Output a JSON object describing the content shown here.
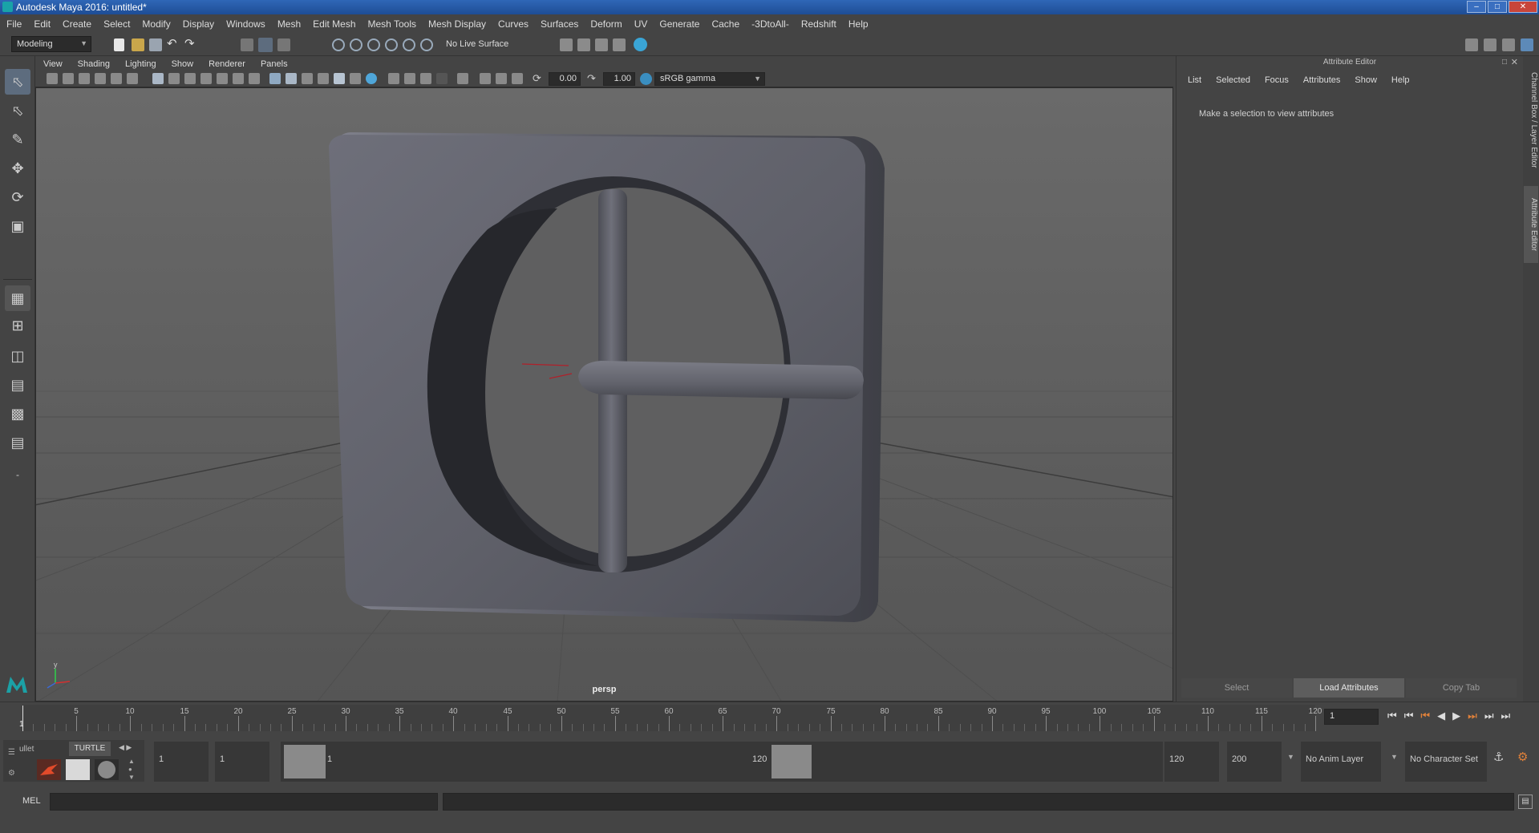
{
  "window": {
    "title": "Autodesk Maya 2016: untitled*"
  },
  "menubar": [
    "File",
    "Edit",
    "Create",
    "Select",
    "Modify",
    "Display",
    "Windows",
    "Mesh",
    "Edit Mesh",
    "Mesh Tools",
    "Mesh Display",
    "Curves",
    "Surfaces",
    "Deform",
    "UV",
    "Generate",
    "Cache",
    "-3DtoAll-",
    "Redshift",
    "Help"
  ],
  "toolbar": {
    "mode": "Modeling",
    "live_surface": "No Live Surface"
  },
  "viewport": {
    "menu": [
      "View",
      "Shading",
      "Lighting",
      "Show",
      "Renderer",
      "Panels"
    ],
    "exposure": "0.00",
    "gamma": "1.00",
    "color_space": "sRGB gamma",
    "camera": "persp"
  },
  "attribute_editor": {
    "title": "Attribute Editor",
    "menu": [
      "List",
      "Selected",
      "Focus",
      "Attributes",
      "Show",
      "Help"
    ],
    "message": "Make a selection to view attributes",
    "buttons": {
      "select": "Select",
      "load": "Load Attributes",
      "copy": "Copy Tab"
    }
  },
  "side_tabs": {
    "channel_box": "Channel Box / Layer Editor",
    "attribute_editor": "Attribute Editor"
  },
  "timeline": {
    "labels": [
      "5",
      "10",
      "15",
      "20",
      "25",
      "30",
      "35",
      "40",
      "45",
      "50",
      "55",
      "60",
      "65",
      "70",
      "75",
      "80",
      "85",
      "90",
      "95",
      "100",
      "105",
      "110",
      "115",
      "120"
    ],
    "first_frame": "1",
    "current_frame": "1"
  },
  "range": {
    "shelf_tabs": [
      "ullet",
      "TURTLE"
    ],
    "start": "1",
    "start2": "1",
    "slider_start": "1",
    "slider_end": "120",
    "end": "120",
    "end2": "200",
    "anim_layer": "No Anim Layer",
    "character_set": "No Character Set"
  },
  "command_line": {
    "label": "MEL"
  }
}
